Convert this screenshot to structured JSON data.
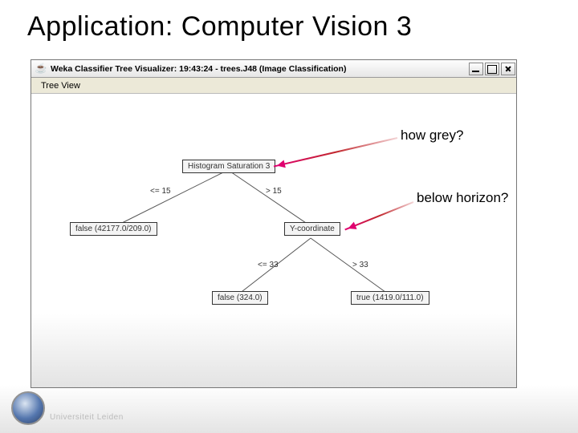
{
  "slide": {
    "title": "Application: Computer Vision 3"
  },
  "window": {
    "title": "Weka Classifier Tree Visualizer: 19:43:24 - trees.J48 (Image Classification)",
    "menu": {
      "tree_view": "Tree View"
    }
  },
  "tree": {
    "root": "Histogram Saturation 3",
    "root_left_op": "<= 15",
    "root_right_op": "> 15",
    "leaf_left": "false (42177.0/209.0)",
    "mid_node": "Y-coordinate",
    "mid_left_op": "<= 33",
    "mid_right_op": "> 33",
    "leaf_mid_left": "false (324.0)",
    "leaf_mid_right": "true (1419.0/111.0)"
  },
  "annotations": {
    "how_grey": "how grey?",
    "below_horizon": "below horizon?"
  },
  "branding": {
    "wordmark": "Universiteit Leiden"
  }
}
